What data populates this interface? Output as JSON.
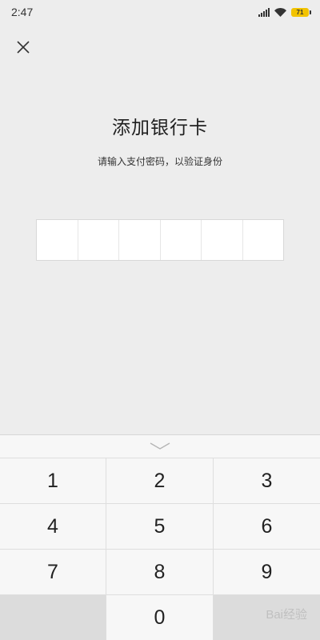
{
  "status_bar": {
    "time": "2:47",
    "battery": "71"
  },
  "header": {
    "close_icon": "close-icon"
  },
  "main": {
    "title": "添加银行卡",
    "subtitle": "请输入支付密码，以验证身份",
    "password_length": 6
  },
  "keypad": {
    "collapse_icon": "chevron-down-icon",
    "keys": [
      "1",
      "2",
      "3",
      "4",
      "5",
      "6",
      "7",
      "8",
      "9",
      "",
      "0",
      ""
    ]
  },
  "watermark": "Bai经验"
}
